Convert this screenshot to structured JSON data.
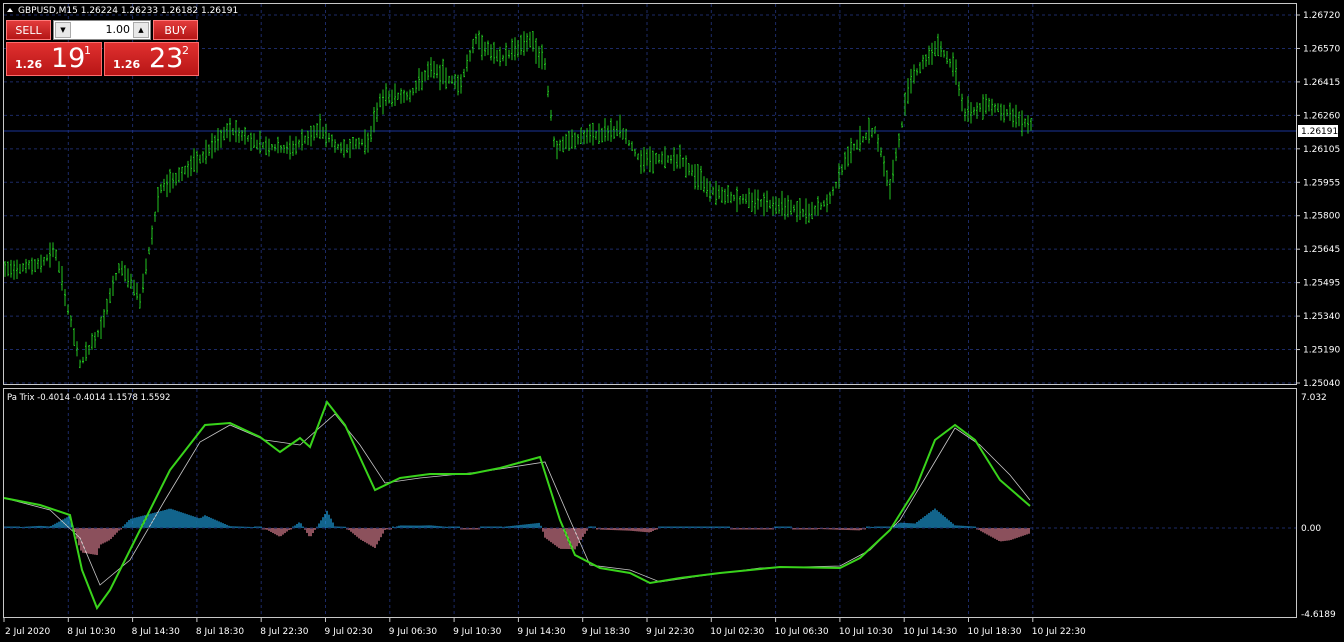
{
  "header": {
    "symbol_info": "GBPUSD,M15  1.26224 1.26233 1.26182 1.26191"
  },
  "trade_panel": {
    "sell_label": "SELL",
    "buy_label": "BUY",
    "lot_value": "1.00",
    "sell_price": {
      "prefix": "1.26",
      "big": "19",
      "sup": "1"
    },
    "buy_price": {
      "prefix": "1.26",
      "big": "23",
      "sup": "2"
    }
  },
  "main_chart": {
    "price_ticks": [
      "1.26720",
      "1.26570",
      "1.26415",
      "1.26260",
      "1.26105",
      "1.25955",
      "1.25800",
      "1.25645",
      "1.25495",
      "1.25340",
      "1.25190",
      "1.25040"
    ],
    "current_price": "1.26191"
  },
  "indicator": {
    "label": "Pa Trix -0.4014 -0.4014 1.1578 1.5592",
    "ticks": [
      "7.032",
      "0.00",
      "-4.6189"
    ]
  },
  "time_axis": [
    "2 Jul 2020",
    "8 Jul 10:30",
    "8 Jul 14:30",
    "8 Jul 18:30",
    "8 Jul 22:30",
    "9 Jul 02:30",
    "9 Jul 06:30",
    "9 Jul 10:30",
    "9 Jul 14:30",
    "9 Jul 18:30",
    "9 Jul 22:30",
    "10 Jul 02:30",
    "10 Jul 06:30",
    "10 Jul 10:30",
    "10 Jul 14:30",
    "10 Jul 18:30",
    "10 Jul 22:30"
  ],
  "colors": {
    "bars": "#22c41f",
    "trix": "#39d31b",
    "signal": "#c8c8c8",
    "hist_pos": "#1ea7e8",
    "hist_neg": "#e8879a",
    "grid": "#1c2a66",
    "frame": "#c8c8c8",
    "price_line": "#1a3399"
  }
}
